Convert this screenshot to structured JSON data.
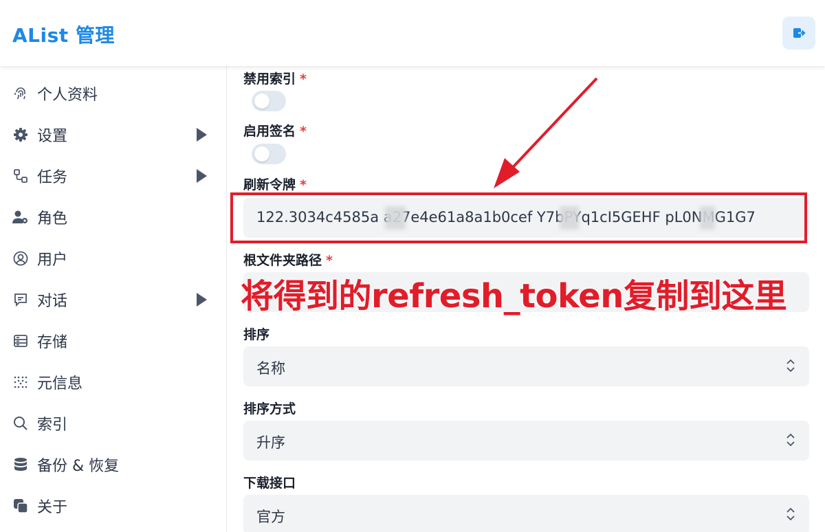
{
  "header": {
    "title": "AList 管理"
  },
  "sidebar": {
    "items": [
      {
        "label": "个人资料",
        "icon": "fingerprint-icon",
        "has_arrow": false
      },
      {
        "label": "设置",
        "icon": "gear-icon",
        "has_arrow": true
      },
      {
        "label": "任务",
        "icon": "flow-icon",
        "has_arrow": true
      },
      {
        "label": "角色",
        "icon": "user-gear-icon",
        "has_arrow": false
      },
      {
        "label": "用户",
        "icon": "user-circle-icon",
        "has_arrow": false
      },
      {
        "label": "对话",
        "icon": "chat-icon",
        "has_arrow": true
      },
      {
        "label": "存储",
        "icon": "storage-icon",
        "has_arrow": false
      },
      {
        "label": "元信息",
        "icon": "meta-icon",
        "has_arrow": false
      },
      {
        "label": "索引",
        "icon": "search-icon",
        "has_arrow": false
      },
      {
        "label": "备份 & 恢复",
        "icon": "database-icon",
        "has_arrow": false
      },
      {
        "label": "关于",
        "icon": "about-icon",
        "has_arrow": false
      }
    ]
  },
  "form": {
    "disable_index": {
      "label": "禁用索引",
      "required": "*",
      "value": false
    },
    "enable_sign": {
      "label": "启用签名",
      "required": "*",
      "value": false
    },
    "refresh_token": {
      "label": "刷新令牌",
      "required": "*",
      "value": "122.3034c4585a a27e4e61a8a1b0cef  Y7bPYq1cI5GEHF  pL0NMG1G7"
    },
    "root_folder": {
      "label": "根文件夹路径",
      "required": "*",
      "value": ""
    },
    "order_by": {
      "label": "排序",
      "value": "名称"
    },
    "order_direction": {
      "label": "排序方式",
      "value": "升序"
    },
    "download_api": {
      "label": "下载接口",
      "value": "官方"
    }
  },
  "annotation": {
    "text": "将得到的refresh_token复制到这里",
    "color": "#e11d2a"
  },
  "colors": {
    "brand": "#1e88e5",
    "accent_bg": "#e4f0fc",
    "required": "#e53e3e",
    "annotation": "#e11d2a"
  }
}
